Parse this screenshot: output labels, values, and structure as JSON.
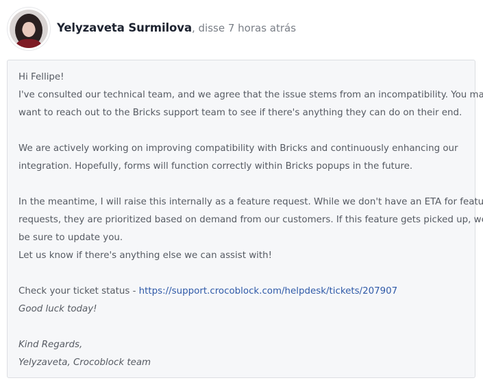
{
  "post": {
    "author": "Yelyzaveta Surmilova",
    "meta": ", disse 7 horas atrás"
  },
  "message": {
    "greeting": "Hi Fellipe!",
    "p1_line1": "I've consulted our technical team, and we agree that the issue stems from an incompatibility. You may",
    "p1_line2": "want to reach out to the Bricks support team to see if there's anything they can do on their end.",
    "p2_line1": "We are actively working on improving compatibility with Bricks and continuously enhancing our",
    "p2_line2": "integration. Hopefully, forms will function correctly within Bricks popups in the future.",
    "p3_line1": "In the meantime, I will raise this internally as a feature request. While we don't have an ETA for feature",
    "p3_line2": "requests, they are prioritized based on demand from our customers. If this feature gets picked up, we will",
    "p3_line3": "be sure to update you.",
    "p3_line4": "Let us know if there's anything else we can assist with!",
    "ticket_prefix": "Check your ticket status - ",
    "ticket_link": "https://support.crocoblock.com/helpdesk/tickets/207907",
    "good_luck": "Good luck today!",
    "sign_off": "Kind Regards,",
    "signature": "Yelyzaveta, Crocoblock team"
  },
  "colors": {
    "link": "#2f5aa8",
    "message_bg": "#f6f7f9",
    "author": "#1d2330"
  },
  "icons": {
    "avatar": "user-avatar-photo"
  }
}
